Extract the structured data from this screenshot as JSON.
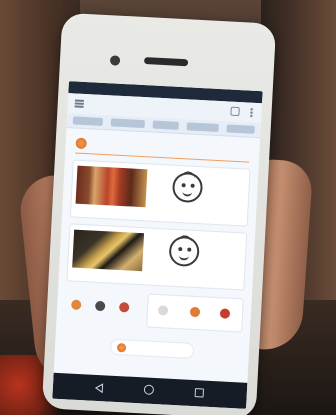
{
  "scene": {
    "description_colors": {
      "phone_body": "#e6e6e3",
      "screen_bg": "#f4f7fb",
      "accent": "#e0762e",
      "status_bar": "#1e2a3a",
      "nav_bar": "#151c26"
    }
  },
  "phone_screen": {
    "status_bar": {
      "left": "",
      "right": ""
    },
    "toolbar": {
      "title": "",
      "icons": [
        "menu-icon",
        "tabs-icon",
        "overflow-icon"
      ]
    },
    "header": {
      "text": ""
    },
    "cards": [
      {
        "caption": "",
        "face_label": "",
        "icons": [
          "photo",
          "smiley-face-icon"
        ]
      },
      {
        "caption": "",
        "face_label": "",
        "icons": [
          "photo",
          "smiley-face-icon"
        ]
      }
    ],
    "icon_row": {
      "label": "",
      "items": [
        "",
        "",
        ""
      ],
      "right_items": [
        "",
        "",
        ""
      ]
    },
    "cta": {
      "label": ""
    },
    "nav": {
      "icons": [
        "back-icon",
        "home-icon",
        "recents-icon"
      ]
    }
  }
}
